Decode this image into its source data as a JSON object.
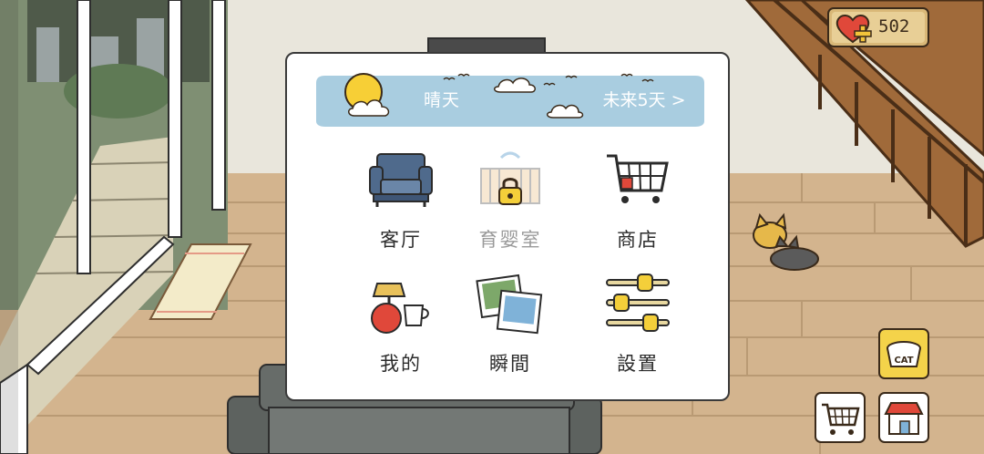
{
  "hud": {
    "heart_count": "502"
  },
  "weather": {
    "condition": "晴天",
    "forecast_button": "未来5天 >"
  },
  "menu": {
    "items": [
      {
        "label": "客厅",
        "enabled": true
      },
      {
        "label": "育婴室",
        "enabled": false
      },
      {
        "label": "商店",
        "enabled": true
      },
      {
        "label": "我的",
        "enabled": true
      },
      {
        "label": "瞬間",
        "enabled": true
      },
      {
        "label": "設置",
        "enabled": true
      }
    ]
  },
  "buttons": {
    "cat_food_label": "CAT"
  },
  "colors": {
    "sky": "#a9cde0",
    "floor": "#d3b48e",
    "wall": "#e9e6dc",
    "panel_border": "#3a3a3a"
  }
}
